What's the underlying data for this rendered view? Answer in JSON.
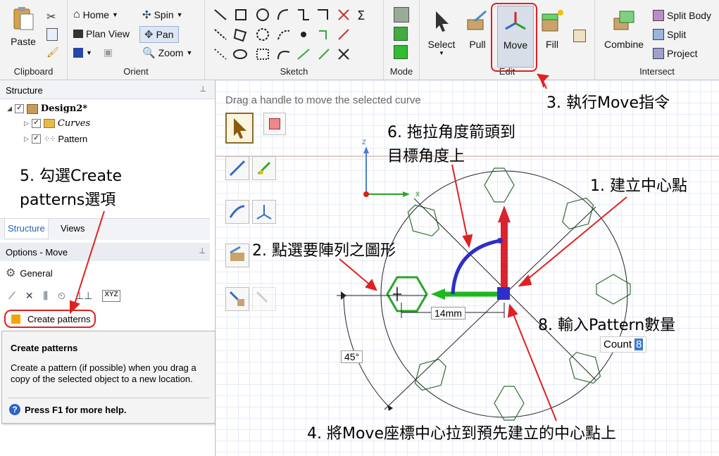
{
  "ribbon": {
    "clipboard": {
      "label": "Clipboard",
      "paste": "Paste"
    },
    "orient": {
      "label": "Orient",
      "home": "Home",
      "plan_view": "Plan View",
      "spin": "Spin",
      "pan": "Pan",
      "zoom": "Zoom"
    },
    "sketch": {
      "label": "Sketch"
    },
    "mode": {
      "label": "Mode"
    },
    "edit": {
      "label": "Edit",
      "select": "Select",
      "pull": "Pull",
      "move": "Move",
      "fill": "Fill"
    },
    "intersect": {
      "label": "Intersect",
      "combine": "Combine",
      "split_body": "Split Body",
      "split": "Split",
      "project": "Project"
    }
  },
  "structure": {
    "title": "Structure",
    "design": "Design2*",
    "curves": "Curves",
    "pattern": "Pattern",
    "tabs": [
      "Structure",
      "Views"
    ]
  },
  "options": {
    "title": "Options - Move",
    "general": "General",
    "create_patterns": "Create patterns"
  },
  "tooltip": {
    "title": "Create patterns",
    "body": "Create a pattern (if possible) when you drag a copy of the selected object to a new location.",
    "help": "Press F1 for more help."
  },
  "canvas": {
    "hint": "Drag a handle to move the selected curve",
    "dim_length": "14mm",
    "dim_angle": "45°",
    "count_label": "Count",
    "count_value": "8",
    "axis_z": "z",
    "axis_x": "x"
  },
  "annotations": {
    "a1": "1. 建立中心點",
    "a2": "2. 點選要陣列之圖形",
    "a3": "3. 執行Move指令",
    "a4": "4. 將Move座標中心拉到預先建立的中心點上",
    "a5_line1": "5. 勾選Create",
    "a5_line2": "patterns選項",
    "a6_line1": "6. 拖拉角度箭頭到",
    "a6_line2": "目標角度上",
    "a8": "8. 輸入Pattern數量"
  },
  "colors": {
    "accent_red": "#e02020",
    "sketch_green": "#2f6e2f",
    "move_axis_green": "#1fb81f",
    "move_axis_red": "#d9232d",
    "move_arc_blue": "#2e2ec8"
  }
}
